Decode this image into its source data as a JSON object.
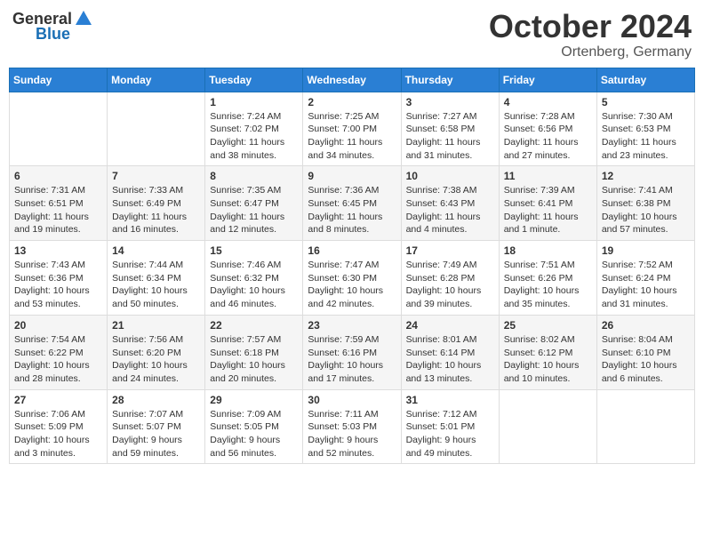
{
  "header": {
    "logo_general": "General",
    "logo_blue": "Blue",
    "month": "October 2024",
    "location": "Ortenberg, Germany"
  },
  "weekdays": [
    "Sunday",
    "Monday",
    "Tuesday",
    "Wednesday",
    "Thursday",
    "Friday",
    "Saturday"
  ],
  "weeks": [
    [
      {
        "day": "",
        "sunrise": "",
        "sunset": "",
        "daylight": ""
      },
      {
        "day": "",
        "sunrise": "",
        "sunset": "",
        "daylight": ""
      },
      {
        "day": "1",
        "sunrise": "Sunrise: 7:24 AM",
        "sunset": "Sunset: 7:02 PM",
        "daylight": "Daylight: 11 hours and 38 minutes."
      },
      {
        "day": "2",
        "sunrise": "Sunrise: 7:25 AM",
        "sunset": "Sunset: 7:00 PM",
        "daylight": "Daylight: 11 hours and 34 minutes."
      },
      {
        "day": "3",
        "sunrise": "Sunrise: 7:27 AM",
        "sunset": "Sunset: 6:58 PM",
        "daylight": "Daylight: 11 hours and 31 minutes."
      },
      {
        "day": "4",
        "sunrise": "Sunrise: 7:28 AM",
        "sunset": "Sunset: 6:56 PM",
        "daylight": "Daylight: 11 hours and 27 minutes."
      },
      {
        "day": "5",
        "sunrise": "Sunrise: 7:30 AM",
        "sunset": "Sunset: 6:53 PM",
        "daylight": "Daylight: 11 hours and 23 minutes."
      }
    ],
    [
      {
        "day": "6",
        "sunrise": "Sunrise: 7:31 AM",
        "sunset": "Sunset: 6:51 PM",
        "daylight": "Daylight: 11 hours and 19 minutes."
      },
      {
        "day": "7",
        "sunrise": "Sunrise: 7:33 AM",
        "sunset": "Sunset: 6:49 PM",
        "daylight": "Daylight: 11 hours and 16 minutes."
      },
      {
        "day": "8",
        "sunrise": "Sunrise: 7:35 AM",
        "sunset": "Sunset: 6:47 PM",
        "daylight": "Daylight: 11 hours and 12 minutes."
      },
      {
        "day": "9",
        "sunrise": "Sunrise: 7:36 AM",
        "sunset": "Sunset: 6:45 PM",
        "daylight": "Daylight: 11 hours and 8 minutes."
      },
      {
        "day": "10",
        "sunrise": "Sunrise: 7:38 AM",
        "sunset": "Sunset: 6:43 PM",
        "daylight": "Daylight: 11 hours and 4 minutes."
      },
      {
        "day": "11",
        "sunrise": "Sunrise: 7:39 AM",
        "sunset": "Sunset: 6:41 PM",
        "daylight": "Daylight: 11 hours and 1 minute."
      },
      {
        "day": "12",
        "sunrise": "Sunrise: 7:41 AM",
        "sunset": "Sunset: 6:38 PM",
        "daylight": "Daylight: 10 hours and 57 minutes."
      }
    ],
    [
      {
        "day": "13",
        "sunrise": "Sunrise: 7:43 AM",
        "sunset": "Sunset: 6:36 PM",
        "daylight": "Daylight: 10 hours and 53 minutes."
      },
      {
        "day": "14",
        "sunrise": "Sunrise: 7:44 AM",
        "sunset": "Sunset: 6:34 PM",
        "daylight": "Daylight: 10 hours and 50 minutes."
      },
      {
        "day": "15",
        "sunrise": "Sunrise: 7:46 AM",
        "sunset": "Sunset: 6:32 PM",
        "daylight": "Daylight: 10 hours and 46 minutes."
      },
      {
        "day": "16",
        "sunrise": "Sunrise: 7:47 AM",
        "sunset": "Sunset: 6:30 PM",
        "daylight": "Daylight: 10 hours and 42 minutes."
      },
      {
        "day": "17",
        "sunrise": "Sunrise: 7:49 AM",
        "sunset": "Sunset: 6:28 PM",
        "daylight": "Daylight: 10 hours and 39 minutes."
      },
      {
        "day": "18",
        "sunrise": "Sunrise: 7:51 AM",
        "sunset": "Sunset: 6:26 PM",
        "daylight": "Daylight: 10 hours and 35 minutes."
      },
      {
        "day": "19",
        "sunrise": "Sunrise: 7:52 AM",
        "sunset": "Sunset: 6:24 PM",
        "daylight": "Daylight: 10 hours and 31 minutes."
      }
    ],
    [
      {
        "day": "20",
        "sunrise": "Sunrise: 7:54 AM",
        "sunset": "Sunset: 6:22 PM",
        "daylight": "Daylight: 10 hours and 28 minutes."
      },
      {
        "day": "21",
        "sunrise": "Sunrise: 7:56 AM",
        "sunset": "Sunset: 6:20 PM",
        "daylight": "Daylight: 10 hours and 24 minutes."
      },
      {
        "day": "22",
        "sunrise": "Sunrise: 7:57 AM",
        "sunset": "Sunset: 6:18 PM",
        "daylight": "Daylight: 10 hours and 20 minutes."
      },
      {
        "day": "23",
        "sunrise": "Sunrise: 7:59 AM",
        "sunset": "Sunset: 6:16 PM",
        "daylight": "Daylight: 10 hours and 17 minutes."
      },
      {
        "day": "24",
        "sunrise": "Sunrise: 8:01 AM",
        "sunset": "Sunset: 6:14 PM",
        "daylight": "Daylight: 10 hours and 13 minutes."
      },
      {
        "day": "25",
        "sunrise": "Sunrise: 8:02 AM",
        "sunset": "Sunset: 6:12 PM",
        "daylight": "Daylight: 10 hours and 10 minutes."
      },
      {
        "day": "26",
        "sunrise": "Sunrise: 8:04 AM",
        "sunset": "Sunset: 6:10 PM",
        "daylight": "Daylight: 10 hours and 6 minutes."
      }
    ],
    [
      {
        "day": "27",
        "sunrise": "Sunrise: 7:06 AM",
        "sunset": "Sunset: 5:09 PM",
        "daylight": "Daylight: 10 hours and 3 minutes."
      },
      {
        "day": "28",
        "sunrise": "Sunrise: 7:07 AM",
        "sunset": "Sunset: 5:07 PM",
        "daylight": "Daylight: 9 hours and 59 minutes."
      },
      {
        "day": "29",
        "sunrise": "Sunrise: 7:09 AM",
        "sunset": "Sunset: 5:05 PM",
        "daylight": "Daylight: 9 hours and 56 minutes."
      },
      {
        "day": "30",
        "sunrise": "Sunrise: 7:11 AM",
        "sunset": "Sunset: 5:03 PM",
        "daylight": "Daylight: 9 hours and 52 minutes."
      },
      {
        "day": "31",
        "sunrise": "Sunrise: 7:12 AM",
        "sunset": "Sunset: 5:01 PM",
        "daylight": "Daylight: 9 hours and 49 minutes."
      },
      {
        "day": "",
        "sunrise": "",
        "sunset": "",
        "daylight": ""
      },
      {
        "day": "",
        "sunrise": "",
        "sunset": "",
        "daylight": ""
      }
    ]
  ]
}
